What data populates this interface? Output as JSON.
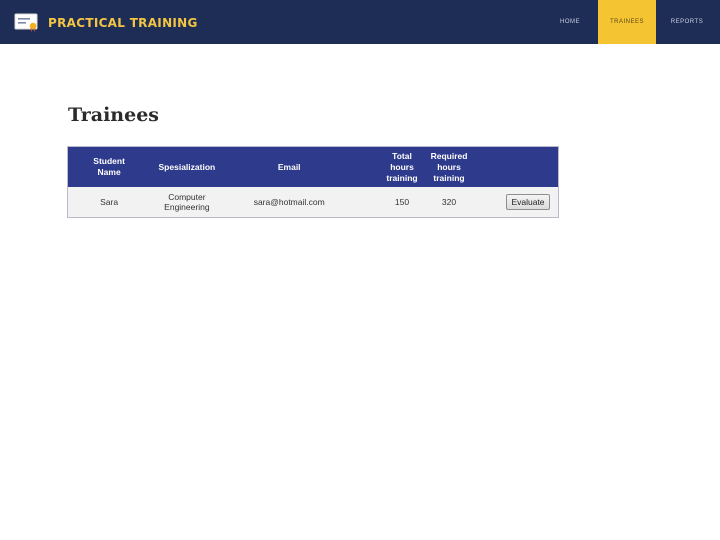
{
  "app": {
    "title": "PRACTICAL TRAINING",
    "logo_icon": "certificate-icon",
    "colors": {
      "header_bg": "#1e2d55",
      "brand_text": "#f2c542",
      "active_tab": "#f5c432",
      "table_header": "#2e3a8c"
    }
  },
  "nav": {
    "items": [
      {
        "label": "HOME",
        "active": false
      },
      {
        "label": "TRAINEES",
        "active": true
      },
      {
        "label": "REPORTS",
        "active": false
      }
    ]
  },
  "page": {
    "title": "Trainees"
  },
  "table": {
    "headers": [
      "Student Name",
      "Spesialization",
      "Email",
      "Total hours training",
      "Required hours training",
      ""
    ],
    "rows": [
      {
        "student_name": "Sara",
        "specialization": "Computer Engineering",
        "email": "sara@hotmail.com",
        "total_hours": "150",
        "required_hours": "320",
        "action_label": "Evaluate"
      }
    ]
  }
}
